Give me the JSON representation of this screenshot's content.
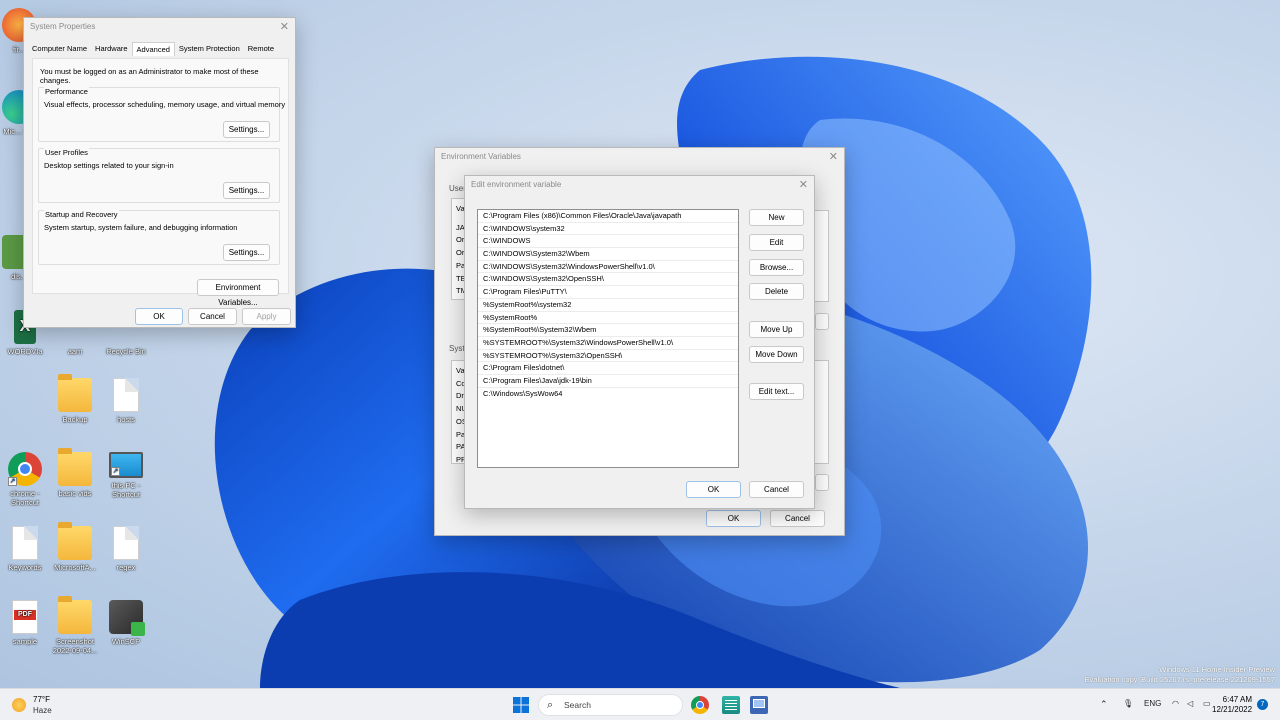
{
  "desktop": {
    "icons": [
      {
        "label": "fir...",
        "type": "app"
      },
      {
        "label": "Mic... E...",
        "type": "app"
      },
      {
        "label": "dis...",
        "type": "app"
      },
      {
        "label": "WORDVIa",
        "type": "excel"
      },
      {
        "label": "aam",
        "type": "app"
      },
      {
        "label": "Recycle Bin",
        "type": "bin"
      },
      {
        "label": "Backup",
        "type": "folder"
      },
      {
        "label": "hosts",
        "type": "doc"
      },
      {
        "label": "chrome - Shortcut",
        "type": "chrome"
      },
      {
        "label": "basic vids",
        "type": "folder"
      },
      {
        "label": "this PC - Shortcut",
        "type": "pc"
      },
      {
        "label": "Keywords",
        "type": "doc"
      },
      {
        "label": "MicrosoftA...",
        "type": "folder"
      },
      {
        "label": "regex",
        "type": "doc"
      },
      {
        "label": "sample",
        "type": "pdf"
      },
      {
        "label": "Screenshot 2022-09-04...",
        "type": "folder"
      },
      {
        "label": "WinSCP",
        "type": "winscp"
      }
    ],
    "watermark_line1": "Windows 11 Home Insider Preview",
    "watermark_line2": "Evaluation copy. Build 25267.rs_prerelease.221209-1557"
  },
  "system_properties": {
    "title": "System Properties",
    "tabs": [
      "Computer Name",
      "Hardware",
      "Advanced",
      "System Protection",
      "Remote"
    ],
    "active_tab": "Advanced",
    "admin_note": "You must be logged on as an Administrator to make most of these changes.",
    "performance": {
      "title": "Performance",
      "desc": "Visual effects, processor scheduling, memory usage, and virtual memory",
      "button": "Settings..."
    },
    "user_profiles": {
      "title": "User Profiles",
      "desc": "Desktop settings related to your sign-in",
      "button": "Settings..."
    },
    "startup": {
      "title": "Startup and Recovery",
      "desc": "System startup, system failure, and debugging information",
      "button": "Settings..."
    },
    "env_button": "Environment Variables...",
    "ok": "OK",
    "cancel": "Cancel",
    "apply": "Apply"
  },
  "environment_variables": {
    "title": "Environment Variables",
    "user_label": "User",
    "user_rows": [
      "Va",
      "JA",
      "Or",
      "Or",
      "Pa",
      "TE",
      "TM"
    ],
    "system_label": "Syste",
    "system_rows": [
      "Va",
      "Co",
      "Dr",
      "NU",
      "OS",
      "Pa",
      "PA",
      "PR"
    ],
    "ok": "OK",
    "cancel": "Cancel"
  },
  "edit_env_var": {
    "title": "Edit environment variable",
    "paths": [
      "C:\\Program Files (x86)\\Common Files\\Oracle\\Java\\javapath",
      "C:\\WINDOWS\\system32",
      "C:\\WINDOWS",
      "C:\\WINDOWS\\System32\\Wbem",
      "C:\\WINDOWS\\System32\\WindowsPowerShell\\v1.0\\",
      "C:\\WINDOWS\\System32\\OpenSSH\\",
      "C:\\Program Files\\PuTTY\\",
      "%SystemRoot%\\system32",
      "%SystemRoot%",
      "%SystemRoot%\\System32\\Wbem",
      "%SYSTEMROOT%\\System32\\WindowsPowerShell\\v1.0\\",
      "%SYSTEMROOT%\\System32\\OpenSSH\\",
      "C:\\Program Files\\dotnet\\",
      "C:\\Program Files\\Java\\jdk-19\\bin",
      "C:\\Windows\\SysWow64"
    ],
    "buttons": {
      "new": "New",
      "edit": "Edit",
      "browse": "Browse...",
      "delete": "Delete",
      "move_up": "Move Up",
      "move_down": "Move Down",
      "edit_text": "Edit text...",
      "ok": "OK",
      "cancel": "Cancel"
    }
  },
  "taskbar": {
    "weather_temp": "77°F",
    "weather_desc": "Haze",
    "search_placeholder": "Search",
    "language": "ENG",
    "time": "6:47 AM",
    "date": "12/21/2022",
    "notification_count": "7"
  },
  "colors": {
    "accent": "#0067c0",
    "wallpaper_blue": "#1a5fe0"
  }
}
